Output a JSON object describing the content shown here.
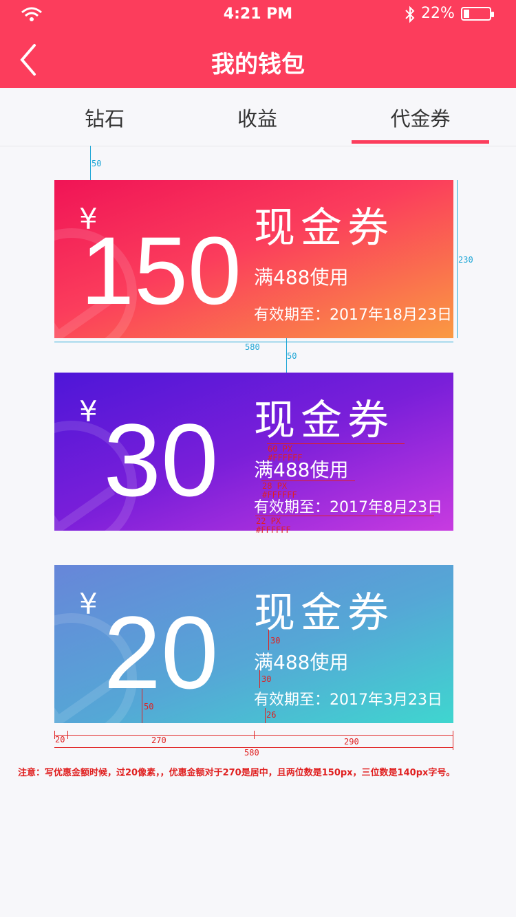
{
  "status_bar": {
    "time": "4:21 PM",
    "battery_percent": "22%"
  },
  "header": {
    "title": "我的钱包",
    "bg_color": "#fc3d5c"
  },
  "tabs": [
    {
      "label": "钻石",
      "active": false
    },
    {
      "label": "收益",
      "active": false
    },
    {
      "label": "代金券",
      "active": true
    }
  ],
  "vouchers": [
    {
      "currency": "¥",
      "amount": "150",
      "title": "现金券",
      "condition": "满488使用",
      "valid_until": "有效期至：2017年18月23日"
    },
    {
      "currency": "¥",
      "amount": "30",
      "title": "现金券",
      "condition": "满488使用",
      "valid_until": "有效期至：2017年8月23日"
    },
    {
      "currency": "¥",
      "amount": "20",
      "title": "现金券",
      "condition": "满488使用",
      "valid_until": "有效期至：2017年3月23日"
    }
  ],
  "annotations": {
    "gap_top": "50",
    "card_height": "230",
    "card_width": "580",
    "gap_between": "50",
    "title_size": "60 PX",
    "title_color": "#FFFFFF",
    "cond_size": "28 PX",
    "cond_color": "#FFFFFF",
    "valid_size": "22 PX",
    "valid_color": "#FFFFFF",
    "spacing_30a": "30",
    "spacing_30b": "30",
    "amount_bottom": "50",
    "valid_bottom": "26",
    "left_pad": "20",
    "left_col": "270",
    "right_col": "290",
    "total": "580"
  },
  "note": "注意：写优惠金额时候，过20像素，，优惠金额对于270是居中，且两位数是150px，三位数是140px字号。"
}
